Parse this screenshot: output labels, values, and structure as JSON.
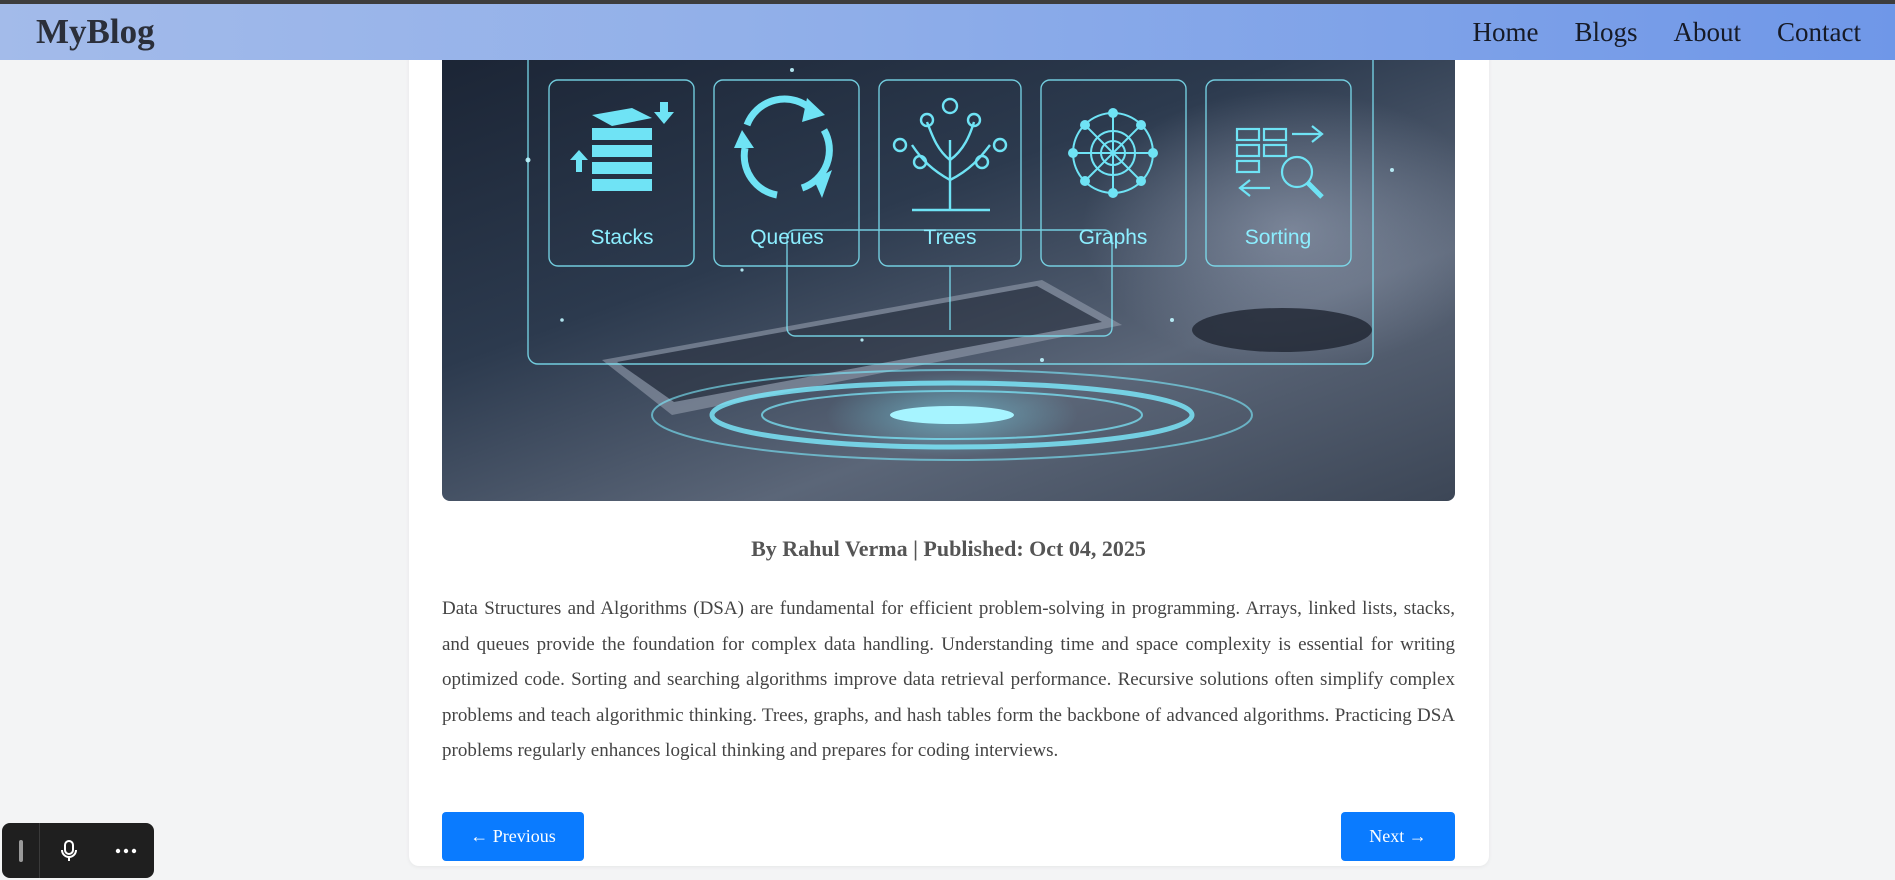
{
  "header": {
    "brand": "MyBlog",
    "nav": [
      {
        "label": "Home"
      },
      {
        "label": "Blogs"
      },
      {
        "label": "About"
      },
      {
        "label": "Contact"
      }
    ]
  },
  "hero": {
    "labels": [
      "Stacks",
      "Queues",
      "Trees",
      "Graphs",
      "Sorting"
    ]
  },
  "post": {
    "meta": "By Rahul Verma | Published: Oct 04, 2025",
    "body": "Data Structures and Algorithms (DSA) are fundamental for efficient problem-solving in programming. Arrays, linked lists, stacks, and queues provide the foundation for complex data handling. Understanding time and space complexity is essential for writing optimized code. Sorting and searching algorithms improve data retrieval performance. Recursive solutions often simplify complex problems and teach algorithmic thinking. Trees, graphs, and hash tables form the backbone of advanced algorithms. Practicing DSA problems regularly enhances logical thinking and prepares for coding interviews."
  },
  "pagination": {
    "prev_label": "← Previous",
    "next_label": "Next →"
  },
  "voice_toolbar": {
    "icons": [
      "drag-handle-icon",
      "microphone-icon",
      "more-icon"
    ]
  },
  "colors": {
    "accent": "#0a7bff",
    "navbar_start": "#a3bbea",
    "navbar_end": "#6f97e8",
    "hero_glow": "#7decff"
  }
}
